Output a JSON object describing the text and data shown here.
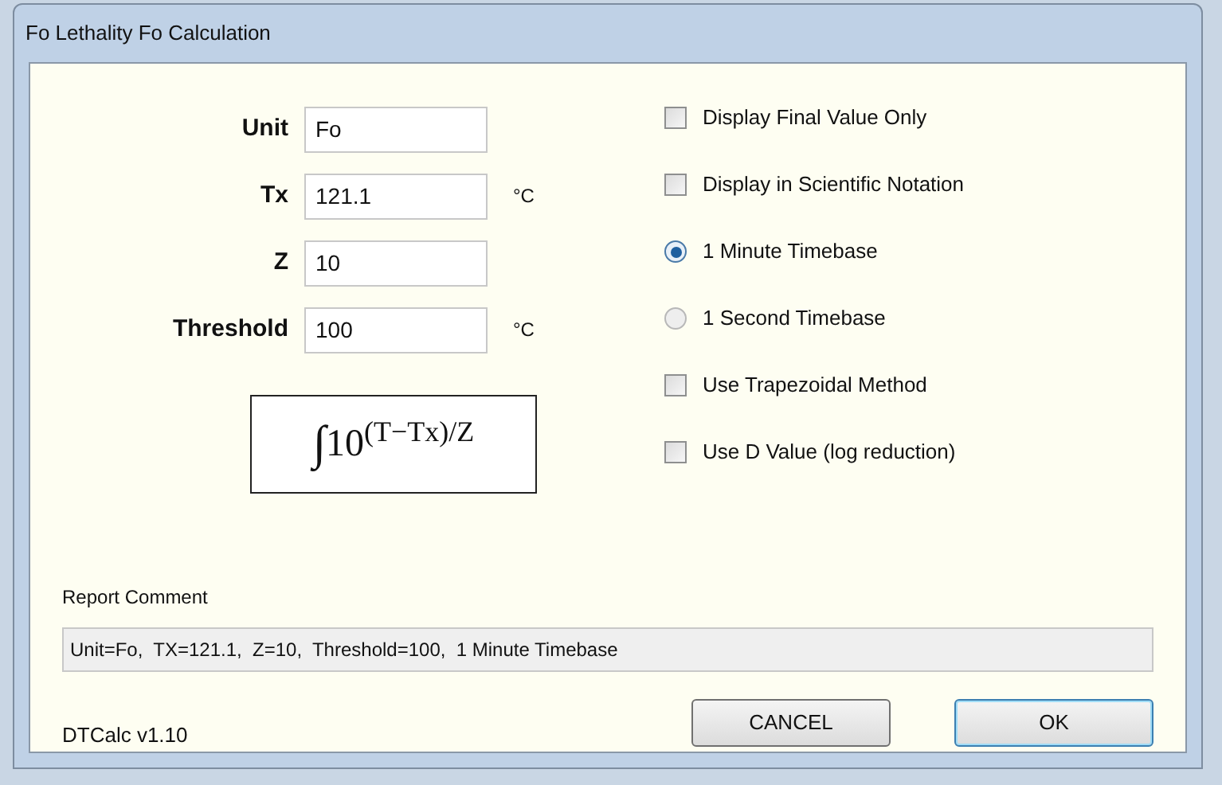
{
  "window": {
    "title": "Fo Lethality Fo Calculation"
  },
  "fields": [
    {
      "label": "Unit",
      "value": "Fo"
    },
    {
      "label": "Tx",
      "value": "121.1",
      "unit": "°C"
    },
    {
      "label": "Z",
      "value": "10"
    },
    {
      "label": "Threshold",
      "value": "100",
      "unit": "°C"
    }
  ],
  "formula": {
    "integral": "∫",
    "expression": "10$^{(T−Tx)/Z}$"
  },
  "options": [
    {
      "kind": "checkbox",
      "label": "Display Final Value Only",
      "checked": false
    },
    {
      "kind": "checkbox",
      "label": "Display in Scientific Notation",
      "checked": false
    },
    {
      "kind": "radio",
      "label": "1 Minute Timebase",
      "selected": true
    },
    {
      "kind": "radio",
      "label": "1 Second Timebase",
      "selected": false
    },
    {
      "kind": "checkbox",
      "label": "Use Trapezoidal Method",
      "checked": false
    },
    {
      "kind": "checkbox",
      "label": "Use D Value (log reduction)",
      "checked": false
    }
  ],
  "report": {
    "label": "Report Comment",
    "value": "Unit=Fo,  TX=121.1,  Z=10,  Threshold=100,  1 Minute Timebase"
  },
  "version": "DTCalc v1.10",
  "buttons": [
    {
      "label": "CANCEL",
      "default": false
    },
    {
      "label": "OK",
      "default": true
    }
  ]
}
